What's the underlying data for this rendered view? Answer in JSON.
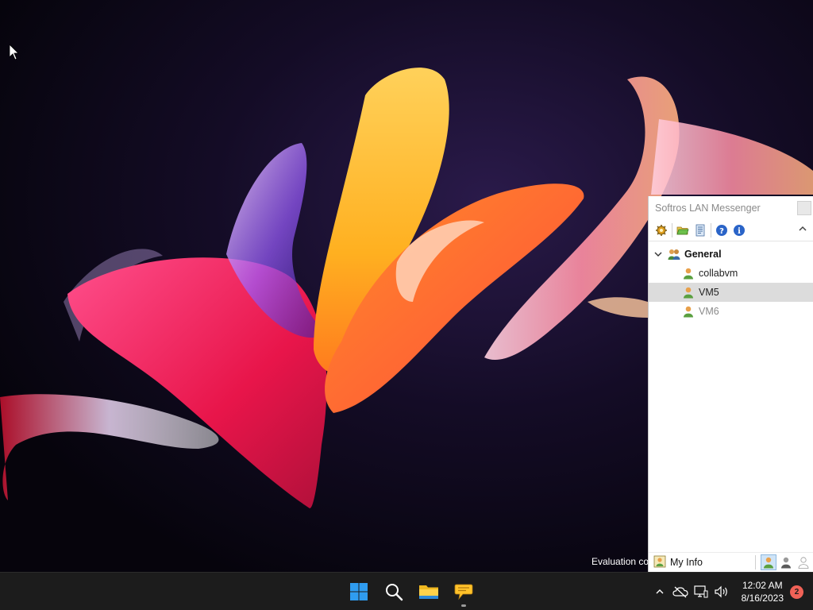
{
  "desktop": {
    "evaluation_text": "Evaluation co"
  },
  "messenger": {
    "title": "Softros LAN Messenger",
    "toolbar": {
      "icons": [
        "settings-icon",
        "open-folder-icon",
        "history-icon",
        "help-icon",
        "info-icon",
        "collapse-icon"
      ]
    },
    "group": {
      "name": "General",
      "expanded": true
    },
    "users": [
      {
        "name": "collabvm",
        "status": "online",
        "selected": false
      },
      {
        "name": "VM5",
        "status": "online",
        "selected": true
      },
      {
        "name": "VM6",
        "status": "offline",
        "selected": false
      }
    ],
    "status_bar": {
      "my_info_label": "My Info",
      "status_icons": [
        "status-online-icon",
        "status-away-icon",
        "status-offline-icon"
      ]
    },
    "colors": {
      "selected_row": "#dcdcdc",
      "active_status": "#cfe4f7"
    }
  },
  "taskbar": {
    "pinned": [
      "start-icon",
      "search-icon",
      "file-explorer-icon",
      "lan-messenger-icon"
    ],
    "clock_time": "12:02 AM",
    "clock_date": "8/16/2023",
    "notification_count": "2",
    "colors": {
      "background": "#1c1c1c",
      "notification_badge": "#f16257"
    }
  }
}
